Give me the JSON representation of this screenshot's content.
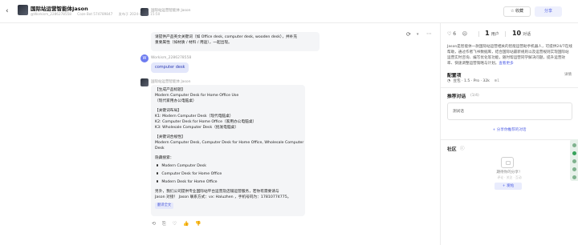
{
  "header": {
    "back_icon": "‹",
    "title": "国际站运营智能体Jason",
    "meta": [
      "@Workism_2286278558",
      "Coze Bot 574789847",
      "发布于 2024-09-24 15:50"
    ],
    "favorite_label": "☆ 收藏",
    "share_label": "分享"
  },
  "chat": {
    "msg1": {
      "sender": "国际站运营智能体 Jason",
      "lines": [
        "请提供产品英文关键词（如 Office desk, computer desk, wooden desk），并补充",
        "重要属性（如材质 / 材料 / 用途），一起出现。"
      ]
    },
    "msg2": {
      "sender": "Workism_2286278558",
      "avatar_letter": "W",
      "text": "computer desk"
    },
    "msg3": {
      "sender": "国际站运营智能体 Jason",
      "block1": [
        "【生成产品标题】",
        "Modern Computer Desk for Home Office Use",
        "（现代家用办公电脑桌）"
      ],
      "block2": [
        "【关键词布局】",
        "K1: Modern Computer Desk（现代电脑桌）",
        "K2: Computer Desk for Home Office（家用办公电脑桌）",
        "K3: Wholesale Computer Desk（批发电脑桌）"
      ],
      "block3": [
        "【关键词合规性】",
        "Modern Computer Desk, Computer Desk for Home Office, Wholesale Computer",
        "Desk"
      ],
      "hidden_label": "隐藏搜索：",
      "bullets": [
        "Modern Computer Desk",
        "Computer Desk for Home Office",
        "Modern Desk for Home Office"
      ],
      "footer_lines": [
        "另外，我们公司提供专业国际站平台运营及店铺运营服务，若你有需要请与",
        "Jason 对接！ Jason 联系方式：vx: Haluzhen ，手机号码为：17810774775。"
      ],
      "chip": "翻译全文",
      "actions": [
        "⟲",
        "⎘",
        "♡",
        "👍",
        "👎"
      ]
    }
  },
  "side": {
    "stats": {
      "likes": "6",
      "uses": "1",
      "uses_label": "用户",
      "turns": "10",
      "turns_label": "对话"
    },
    "description": "Jason是智能体一款国际站运营相关的智能运营助手机器人，可提供24/7在线帮助，通过作者飞书数据库，结合国际站最新规则以及运营规则实现国际站运营实时咨询、编写优化等功能，随时帮运营同学解决问题，提升运营效率、快速调整运营策略与计划。",
    "description_more": "查看更多",
    "config_title": "配置项",
    "config_right": "详情",
    "model": "豆包 · 1.5 · Pro · 32k",
    "model_extra": "⊕1",
    "rec_title": "推荐对话",
    "rec_count": "(1/4)",
    "rec_item": "测试话",
    "add_rec": "+ 分享你推荐的对话",
    "community_title": "社区",
    "empty_text": "期待你的分享！",
    "empty_sub": "评论 · 关注 · 互动",
    "publish": "发帖"
  }
}
